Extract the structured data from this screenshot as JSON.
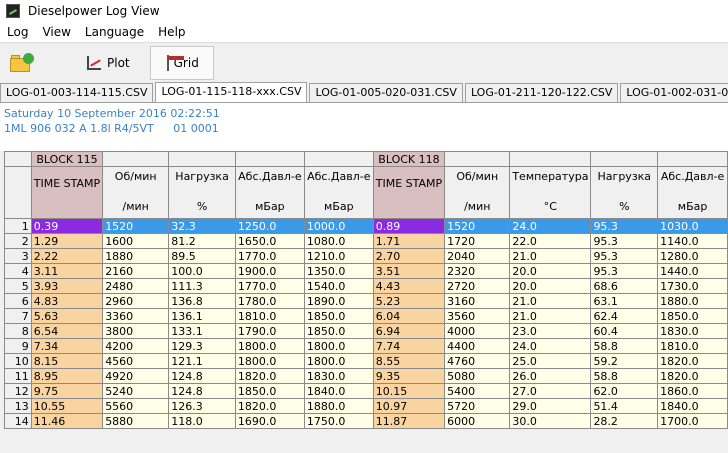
{
  "window": {
    "title": "Dieselpower Log View"
  },
  "menu": [
    "Log",
    "View",
    "Language",
    "Help"
  ],
  "toolbar": {
    "open_icon": "open-folder-icon",
    "plot_label": "Plot",
    "grid_label": "Grid"
  },
  "tabs": [
    "LOG-01-003-114-115.CSV",
    "LOG-01-115-118-xxx.CSV",
    "LOG-01-005-020-031.CSV",
    "LOG-01-211-120-122.CSV",
    "LOG-01-002-031-032.CSV",
    "LOG-01-0"
  ],
  "active_tab": 1,
  "info": {
    "date": "Saturday 10 September 2016 02:22:51",
    "engine": "1ML 906 032 A  1.8l R4/5VT",
    "code": "01 0001"
  },
  "grid": {
    "blocks": [
      {
        "label": "BLOCK 115",
        "span": 1
      },
      {
        "label": "BLOCK 118",
        "span": 1
      }
    ],
    "columns": [
      {
        "name": "TIME STAMP",
        "unit": "",
        "ts": true
      },
      {
        "name": "Об/мин",
        "unit": "/мин"
      },
      {
        "name": "Нагрузка",
        "unit": "%"
      },
      {
        "name": "Абс.Давл-е",
        "unit": "мБар"
      },
      {
        "name": "Абс.Давл-е",
        "unit": "мБар"
      },
      {
        "name": "TIME STAMP",
        "unit": "",
        "ts": true
      },
      {
        "name": "Об/мин",
        "unit": "/мин"
      },
      {
        "name": "Температура",
        "unit": "°C"
      },
      {
        "name": "Нагрузка",
        "unit": "%"
      },
      {
        "name": "Абс.Давл-е",
        "unit": "мБар"
      }
    ],
    "selected_row": 0,
    "rows": [
      [
        "1",
        "0.39",
        "1520",
        "32.3",
        "1250.0",
        "1000.0",
        "0.89",
        "1520",
        "24.0",
        "95.3",
        "1030.0"
      ],
      [
        "2",
        "1.29",
        "1600",
        "81.2",
        "1650.0",
        "1080.0",
        "1.71",
        "1720",
        "22.0",
        "95.3",
        "1140.0"
      ],
      [
        "3",
        "2.22",
        "1880",
        "89.5",
        "1770.0",
        "1210.0",
        "2.70",
        "2040",
        "21.0",
        "95.3",
        "1280.0"
      ],
      [
        "4",
        "3.11",
        "2160",
        "100.0",
        "1900.0",
        "1350.0",
        "3.51",
        "2320",
        "20.0",
        "95.3",
        "1440.0"
      ],
      [
        "5",
        "3.93",
        "2480",
        "111.3",
        "1770.0",
        "1540.0",
        "4.43",
        "2720",
        "20.0",
        "68.6",
        "1730.0"
      ],
      [
        "6",
        "4.83",
        "2960",
        "136.8",
        "1780.0",
        "1890.0",
        "5.23",
        "3160",
        "21.0",
        "63.1",
        "1880.0"
      ],
      [
        "7",
        "5.63",
        "3360",
        "136.1",
        "1810.0",
        "1850.0",
        "6.04",
        "3560",
        "21.0",
        "62.4",
        "1850.0"
      ],
      [
        "8",
        "6.54",
        "3800",
        "133.1",
        "1790.0",
        "1850.0",
        "6.94",
        "4000",
        "23.0",
        "60.4",
        "1830.0"
      ],
      [
        "9",
        "7.34",
        "4200",
        "129.3",
        "1800.0",
        "1800.0",
        "7.74",
        "4400",
        "24.0",
        "58.8",
        "1810.0"
      ],
      [
        "10",
        "8.15",
        "4560",
        "121.1",
        "1800.0",
        "1800.0",
        "8.55",
        "4760",
        "25.0",
        "59.2",
        "1820.0"
      ],
      [
        "11",
        "8.95",
        "4920",
        "124.8",
        "1820.0",
        "1830.0",
        "9.35",
        "5080",
        "26.0",
        "58.8",
        "1820.0"
      ],
      [
        "12",
        "9.75",
        "5240",
        "124.8",
        "1850.0",
        "1840.0",
        "10.15",
        "5400",
        "27.0",
        "62.0",
        "1860.0"
      ],
      [
        "13",
        "10.55",
        "5560",
        "126.3",
        "1820.0",
        "1880.0",
        "10.97",
        "5720",
        "29.0",
        "51.4",
        "1840.0"
      ],
      [
        "14",
        "11.46",
        "5880",
        "118.0",
        "1690.0",
        "1750.0",
        "11.87",
        "6000",
        "30.0",
        "28.2",
        "1700.0"
      ]
    ]
  }
}
